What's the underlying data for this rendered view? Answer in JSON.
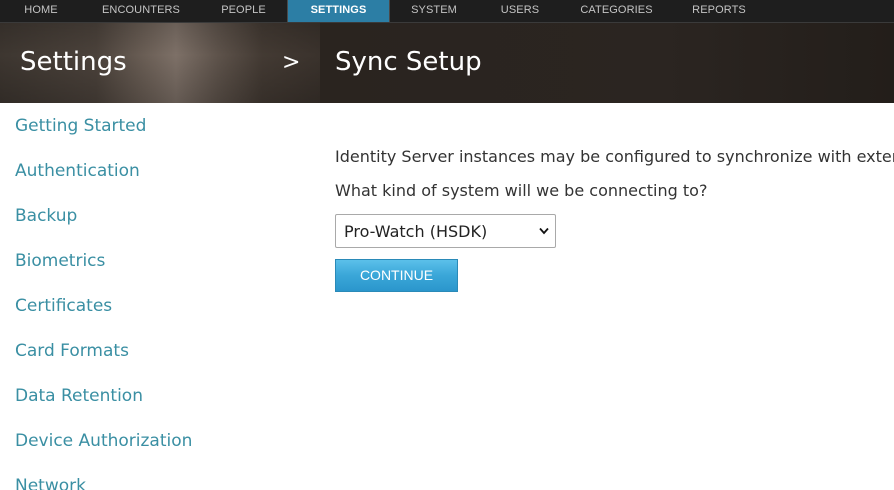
{
  "topnav": {
    "items": [
      {
        "label": "HOME"
      },
      {
        "label": "ENCOUNTERS"
      },
      {
        "label": "PEOPLE"
      },
      {
        "label": "SETTINGS",
        "active": true
      },
      {
        "label": "SYSTEM"
      },
      {
        "label": "USERS"
      },
      {
        "label": "CATEGORIES"
      },
      {
        "label": "REPORTS"
      }
    ]
  },
  "header": {
    "section_title": "Settings",
    "separator": ">",
    "page_title": "Sync Setup"
  },
  "sidebar": {
    "items": [
      {
        "label": "Getting Started"
      },
      {
        "label": "Authentication"
      },
      {
        "label": "Backup"
      },
      {
        "label": "Biometrics"
      },
      {
        "label": "Certificates"
      },
      {
        "label": "Card Formats"
      },
      {
        "label": "Data Retention"
      },
      {
        "label": "Device Authorization"
      },
      {
        "label": "Network"
      }
    ]
  },
  "main": {
    "intro": "Identity Server instances may be configured to synchronize with extern",
    "question": "What kind of system will we be connecting to?",
    "system_select": {
      "selected": "Pro-Watch (HSDK)"
    },
    "continue_label": "CONTINUE"
  },
  "colors": {
    "nav_bg": "#1e1e1e",
    "nav_active": "#2c7ea5",
    "link": "#3a8fa3",
    "button": "#3aa6d8",
    "text": "#333333"
  }
}
